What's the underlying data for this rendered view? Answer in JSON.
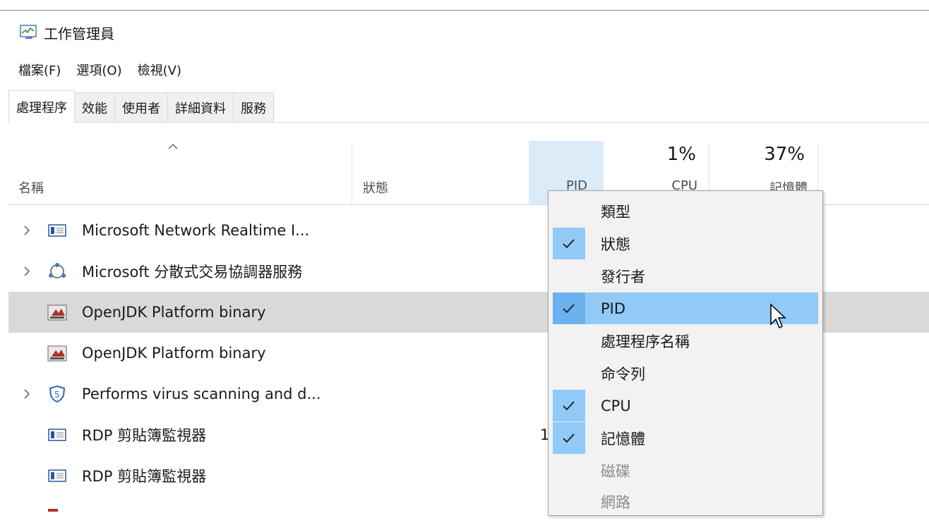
{
  "window": {
    "title": "工作管理員"
  },
  "menu": [
    "檔案(F)",
    "選項(O)",
    "檢視(V)"
  ],
  "tabs": [
    "處理程序",
    "效能",
    "使用者",
    "詳細資料",
    "服務"
  ],
  "active_tab": 0,
  "columns": {
    "name": "名稱",
    "status": "狀態",
    "pid": "PID",
    "cpu_percent": "1%",
    "cpu": "CPU",
    "memory_percent": "37%",
    "memory": "記憶體"
  },
  "processes": [
    {
      "name": "Microsoft Network Realtime I...",
      "expandable": true,
      "icon": "service-icon",
      "pid": ""
    },
    {
      "name": "Microsoft 分散式交易協調器服務",
      "expandable": true,
      "icon": "dtc-icon",
      "pid": ""
    },
    {
      "name": "OpenJDK Platform binary",
      "expandable": false,
      "icon": "java-icon",
      "pid": "",
      "selected": true
    },
    {
      "name": "OpenJDK Platform binary",
      "expandable": false,
      "icon": "java-icon",
      "pid": ""
    },
    {
      "name": "Performs virus scanning and d...",
      "expandable": true,
      "icon": "antivirus-icon",
      "pid": ""
    },
    {
      "name": "RDP 剪貼簿監視器",
      "expandable": false,
      "icon": "service-icon",
      "pid": "1"
    },
    {
      "name": "RDP 剪貼簿監視器",
      "expandable": false,
      "icon": "service-icon",
      "pid": ""
    }
  ],
  "context_menu": [
    {
      "label": "類型",
      "checked": false,
      "disabled": false
    },
    {
      "label": "狀態",
      "checked": true,
      "disabled": false
    },
    {
      "label": "發行者",
      "checked": false,
      "disabled": false
    },
    {
      "label": "PID",
      "checked": true,
      "disabled": false,
      "hover": true
    },
    {
      "label": "處理程序名稱",
      "checked": false,
      "disabled": false
    },
    {
      "label": "命令列",
      "checked": false,
      "disabled": false
    },
    {
      "label": "CPU",
      "checked": true,
      "disabled": false
    },
    {
      "label": "記憶體",
      "checked": true,
      "disabled": false
    },
    {
      "label": "磁碟",
      "checked": false,
      "disabled": true
    },
    {
      "label": "網路",
      "checked": false,
      "disabled": true
    }
  ],
  "colors": {
    "selection_row": "#d9d9d9",
    "menu_hover": "#91c9f7",
    "column_highlight": "#dcebf8"
  }
}
